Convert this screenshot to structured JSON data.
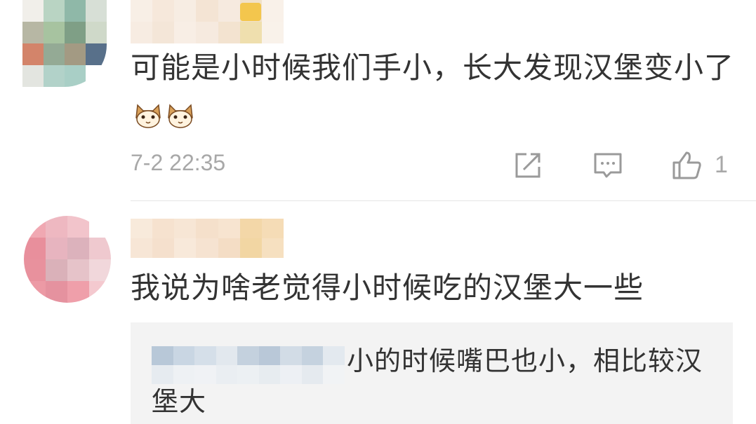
{
  "comments": [
    {
      "text": "可能是小时候我们手小，长大发现汉堡变小了",
      "emojis": [
        "cat-face-emoji",
        "cat-face-emoji"
      ],
      "time": "7-2 22:35",
      "like_count": "1",
      "actions": [
        "repost-icon",
        "comment-icon",
        "like-icon"
      ]
    },
    {
      "text": "我说为啥老觉得小时候吃的汉堡大一些",
      "reply": {
        "text": "小的时候嘴巴也小，相比较汉堡大"
      }
    }
  ],
  "colors": {
    "text": "#333333",
    "meta": "#a8a8a8",
    "reply_bg": "#f3f3f3",
    "divider": "#e5e5e5",
    "vip_badge": "#f3c64d"
  }
}
